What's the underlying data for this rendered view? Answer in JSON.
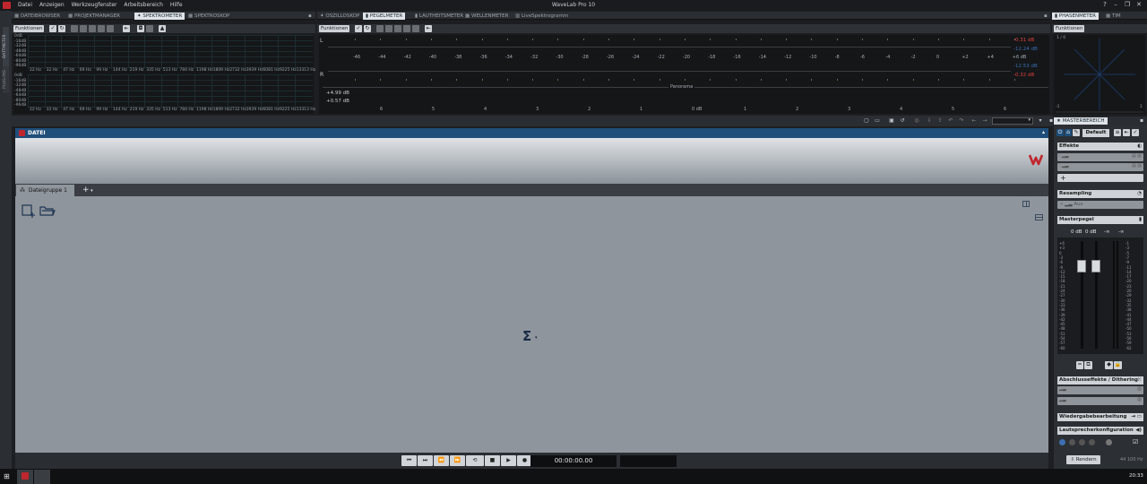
{
  "window": {
    "title": "WaveLab Pro 10",
    "menu": [
      "Datei",
      "Anzeigen",
      "Werkzeugfenster",
      "Arbeitsbereich",
      "Hilfe"
    ]
  },
  "left_rail": {
    "items": [
      "BATTMETER",
      "PLUG-INS"
    ]
  },
  "top_left_panel": {
    "tabs": [
      "DATEIBROWSER",
      "PROJEKTMANAGER",
      "SPEKTROMETER",
      "SPEKTROSKOP"
    ],
    "active_tab": "SPEKTROMETER",
    "functions_label": "Funktionen",
    "db_labels_top": [
      "0dB",
      "-16dB",
      "-32dB",
      "-48dB",
      "-64dB",
      "-80dB",
      "-96dB"
    ],
    "db_labels_bottom": [
      "0dB",
      "-16dB",
      "-32dB",
      "-48dB",
      "-64dB",
      "-80dB",
      "-96dB"
    ],
    "freq_labels": [
      "22 Hz",
      "32 Hz",
      "47 Hz",
      "69 Hz",
      "99 Hz",
      "144 Hz",
      "219 Hz",
      "335 Hz",
      "513 Hz",
      "784 Hz",
      "1198 Hz",
      "1809 Hz",
      "2732 Hz",
      "3939 Hz",
      "6081 Hz",
      "9225 Hz",
      "13313 Hz"
    ]
  },
  "top_mid_panel": {
    "tabs": [
      "OSZILLOSKOP",
      "PEGELMETER",
      "LAUTHEITSMETER",
      "WELLENMETER",
      "LiveSpektrogramm"
    ],
    "active_tab": "PEGELMETER",
    "functions_label": "Funktionen",
    "channel_left": "L",
    "channel_right": "R",
    "level_scale": [
      "-46",
      "-44",
      "-42",
      "-40",
      "-38",
      "-36",
      "-34",
      "-32",
      "-30",
      "-28",
      "-26",
      "-24",
      "-22",
      "-20",
      "-18",
      "-16",
      "-14",
      "-12",
      "-10",
      "-8",
      "-6",
      "-4",
      "-2",
      "0",
      "+2",
      "+4",
      "+6 dB"
    ],
    "peaks": {
      "l_peak": "-0.31 dB",
      "l_rms": "-12.24 dB",
      "r_rms": "-12.53 dB",
      "r_peak": "-0.32 dB"
    },
    "panorama_label": "Panorama",
    "panorama_values": [
      "+4.99 dB",
      "+0.57 dB"
    ],
    "panorama_scale": [
      "6",
      "5",
      "4",
      "3",
      "2",
      "1",
      "0 dB",
      "1",
      "2",
      "3",
      "4",
      "5",
      "6"
    ]
  },
  "top_right_panel": {
    "tabs": [
      "PHASENMETER",
      "TIM"
    ],
    "active_tab": "PHASENMETER",
    "functions_label": "Funktionen",
    "corner_top": "1",
    "corner_top2": "0",
    "corner_left": "-1",
    "corner_right": "1"
  },
  "file_panel": {
    "header": "DATEI",
    "group_tab": "Dateigruppe 1",
    "add_label": "+",
    "center_symbol": "Σ"
  },
  "transport": {
    "time": "00:00:00.00"
  },
  "master": {
    "title": "MASTERBEREICH",
    "preset": "Default",
    "effects_title": "Effekte",
    "resampling_title": "Resampling",
    "resampling_value": "Aus",
    "masterpegel_title": "Masterpegel",
    "level_values": [
      "0 dB",
      "0 dB",
      "-∞",
      "-∞"
    ],
    "fader_scale": [
      "+6",
      "+3",
      "0",
      "-3",
      "-6",
      "-9",
      "-12",
      "-15",
      "-18",
      "-21",
      "-24",
      "-27",
      "-30",
      "-33",
      "-36",
      "-39",
      "-42",
      "-45",
      "-48",
      "-51",
      "-54",
      "-57",
      "-60"
    ],
    "meter_scale": [
      "-1",
      "-3",
      "-5",
      "-7",
      "-9",
      "-11",
      "-14",
      "-17",
      "-20",
      "-23",
      "-26",
      "-29",
      "-32",
      "-35",
      "-38",
      "-41",
      "-44",
      "-47",
      "-50",
      "-53",
      "-56",
      "-59",
      "-62"
    ],
    "final_effects_title": "Abschlusseffekte / Dithering",
    "playback_title": "Wiedergabebearbeitung",
    "speaker_title": "Lautsprecherkonfiguration",
    "render_label": "Rendern",
    "sample_rate": "44 100 Hz"
  },
  "taskbar": {
    "clock": "20:33"
  },
  "colors": {
    "accent_blue": "#1f4e7a",
    "peak_red": "#e0413d",
    "rms_blue": "#3d6fb0",
    "brand_red": "#c0262d"
  }
}
